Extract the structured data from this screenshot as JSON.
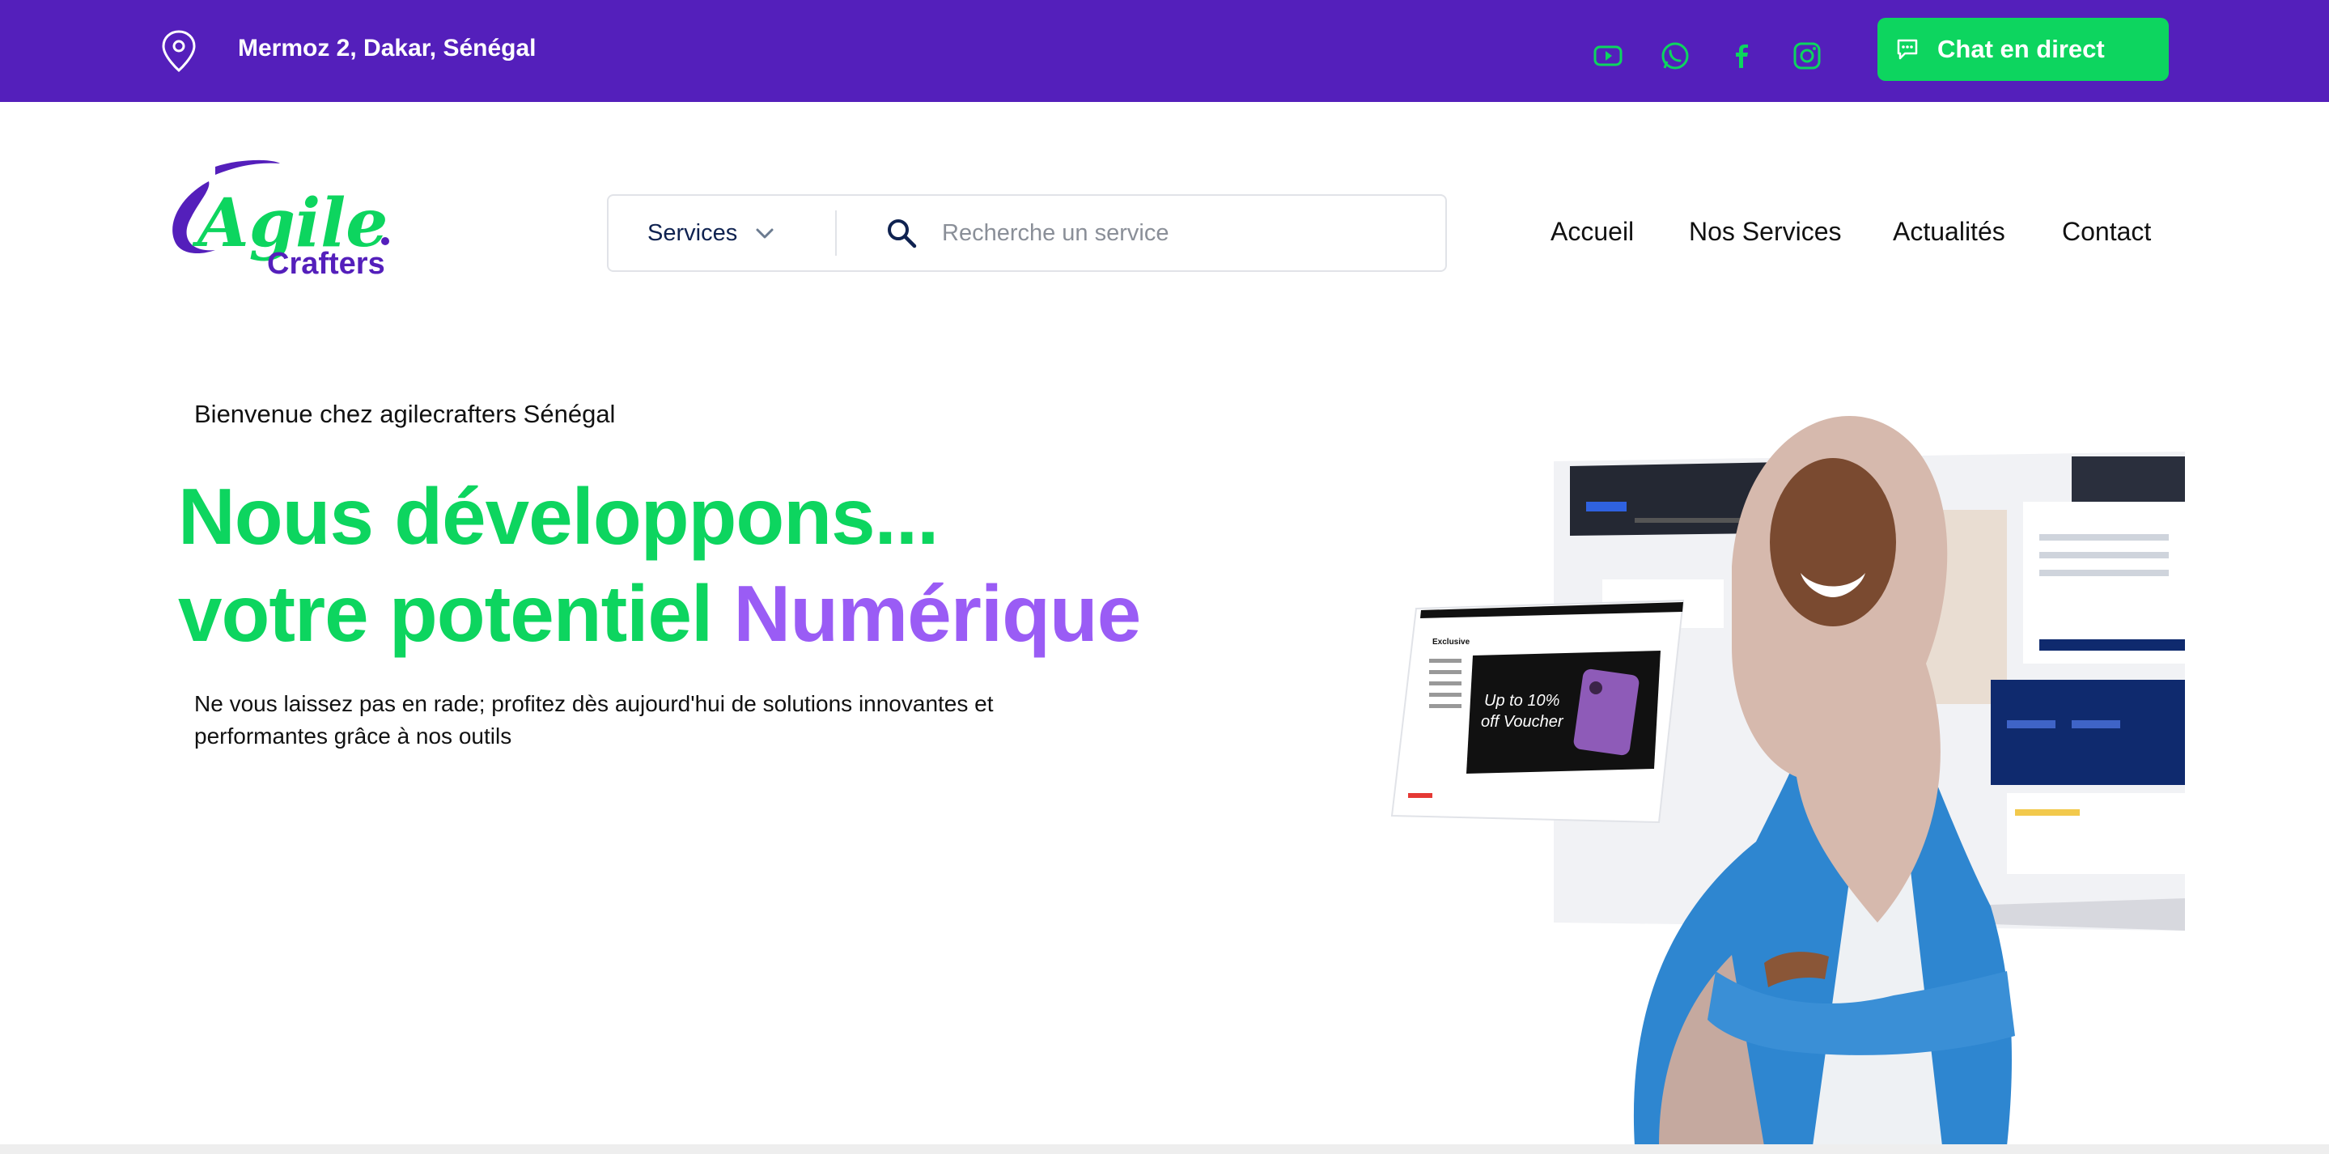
{
  "topbar": {
    "location_icon": "map-pin-icon",
    "location": "Mermoz 2, Dakar, Sénégal",
    "socials": [
      {
        "name": "youtube",
        "icon": "youtube-icon"
      },
      {
        "name": "whatsapp",
        "icon": "whatsapp-icon"
      },
      {
        "name": "facebook",
        "icon": "facebook-icon"
      },
      {
        "name": "instagram",
        "icon": "instagram-icon"
      }
    ],
    "chat_button": {
      "label": "Chat en direct",
      "icon": "chat-bubble-icon"
    }
  },
  "header": {
    "logo": {
      "line1": "Agile",
      "line2": "Crafters"
    },
    "search": {
      "category_label": "Services",
      "placeholder": "Recherche un service"
    },
    "nav": [
      "Accueil",
      "Nos Services",
      "Actualités",
      "Contact"
    ]
  },
  "hero": {
    "welcome": "Bienvenue chez agilecrafters Sénégal",
    "headline_line1": "Nous développons...",
    "headline_line2_prefix": "votre potentiel ",
    "headline_line2_accent": "Numérique",
    "description": "Ne vous laissez pas en rade; profitez dès aujourd'hui de solutions innovantes et performantes grâce à nos outils",
    "mockup_promo": {
      "line1": "Up to 10%",
      "line2": "off Voucher"
    }
  },
  "colors": {
    "brand_purple": "#541fbb",
    "brand_green": "#0dd55f",
    "accent_purple": "#9a5cf5",
    "text_dark": "#111111",
    "nav_blue": "#0f2250"
  }
}
